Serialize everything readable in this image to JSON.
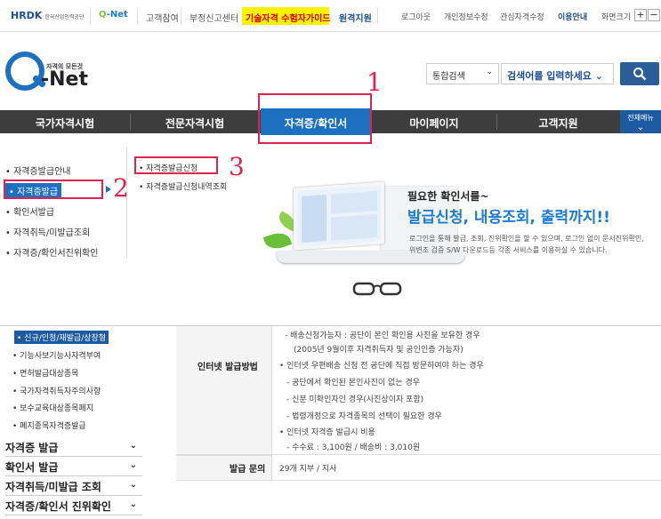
{
  "topbar": {
    "hrdk_logo": "HRDK",
    "hrdk_sub": "한국산업인력공단",
    "qnet_logo_a": "Q",
    "qnet_logo_b": "-Net",
    "links": [
      "고객참여",
      "부정신고센터"
    ],
    "highlight_link": "기술자격 수험자가이드",
    "remote_link": "원격지원",
    "right_links": [
      "로그아웃",
      "개인정보수정",
      "관심자격수정",
      "이용안내",
      "화면크기"
    ],
    "zoom_in": "+",
    "zoom_out": "−"
  },
  "logo": {
    "small": "자격의 모든것",
    "name": "-Net"
  },
  "search": {
    "scope": "통합검색",
    "placeholder": "검색어를 입력하세요"
  },
  "gnb": {
    "items": [
      "국가자격시험",
      "전문자격시험",
      "자격증/확인서",
      "마이페이지",
      "고객지원"
    ],
    "all_menu": "전체메뉴"
  },
  "dropdown": {
    "col1": [
      "자격증발급안내",
      "자격증발급",
      "확인서발급",
      "자격취득/미발급조회",
      "자격증/확인서진위확인"
    ],
    "col2": [
      "자격증발급신청",
      "자격증발급신청내역조회"
    ]
  },
  "annotations": {
    "n1": "1",
    "n2": "2",
    "n3": "3",
    "color": "#e0234e"
  },
  "banner": {
    "title1": "필요한 확인서를~",
    "title2": "발급신청, 내용조회, 출력까지!!",
    "desc1": "로그인을 통해 발급, 조회, 진위확인을 할 수 있으며, 로그인 없이 문서진위확인,",
    "desc2": "위변조 검증 S/W 다운로드등 각종 서비스를 이용하실 수 있습니다."
  },
  "lnb": {
    "sub_items": [
      "신규/인정/재발급/상장형",
      "기능사보기능사자격부여",
      "면허발급대상종목",
      "국가자격취득자주의사항",
      "보수교육대상종목폐지",
      "폐지종목자격증발급"
    ],
    "main_items": [
      "자격증 발급",
      "확인서 발급",
      "자격취득/미발급 조회",
      "자격증/확인서 진위확인"
    ]
  },
  "table": {
    "row1_header": "인터넷 발급방법",
    "row1_lines": [
      "- 배송신청가능자 : 공단이 본인 확인용 사진을 보유한 경우",
      "(2005년 9월이후 자격취득자 및 공인인증 가능자)",
      "• 인터넷 우편배송 신청 전 공단에 직접 방문하여야 하는 경우",
      "- 공단에서 확인된 본인사진이 없는 경우",
      "- 신분 미확인자인 경우(사진상이자 포함)",
      "- 법령개정으로 자격종목의 선택이 필요한 경우",
      "• 인터넷 자격증 발급시 비용",
      "- 수수료 : 3,100원 / 배송비 : 3,010원"
    ],
    "row2_header": "발급 문의",
    "row2_value": "29개 지부 / 지사"
  },
  "colors": {
    "brand": "#1d6fc0",
    "gnb_bg": "#3d3d3d",
    "highlight": "#fff200"
  }
}
